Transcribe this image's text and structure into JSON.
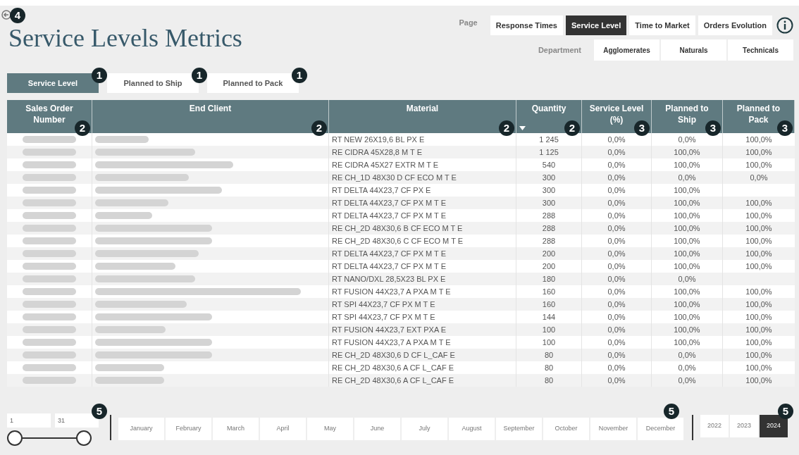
{
  "back": {
    "badge": "4"
  },
  "title": "Service Levels Metrics",
  "page_nav": {
    "label": "Page",
    "items": [
      {
        "label": "Response Times",
        "selected": false
      },
      {
        "label": "Service Level",
        "selected": true
      },
      {
        "label": "Time to Market",
        "selected": false
      },
      {
        "label": "Orders Evolution",
        "selected": false
      }
    ]
  },
  "department": {
    "label": "Department",
    "items": [
      {
        "label": "Agglomerates",
        "selected": false
      },
      {
        "label": "Naturals",
        "selected": false
      },
      {
        "label": "Technicals",
        "selected": false
      }
    ]
  },
  "view_tabs": [
    {
      "label": "Service Level",
      "selected": true,
      "badge": "1"
    },
    {
      "label": "Planned to Ship",
      "selected": false,
      "badge": "1"
    },
    {
      "label": "Planned to Pack",
      "selected": false,
      "badge": "1"
    }
  ],
  "table": {
    "columns": [
      {
        "label": "Sales Order Number",
        "badge": "2",
        "sorted": false
      },
      {
        "label": "End Client",
        "badge": "2",
        "sorted": false
      },
      {
        "label": "Material",
        "badge": "2",
        "sorted": false
      },
      {
        "label": "Quantity",
        "badge": "2",
        "sorted": true
      },
      {
        "label": "Service Level (%)",
        "badge": "3",
        "sorted": false
      },
      {
        "label": "Planned to Ship",
        "badge": "3",
        "sorted": false
      },
      {
        "label": "Planned to Pack",
        "badge": "3",
        "sorted": false
      }
    ],
    "rows": [
      {
        "material": "RT NEW 26X19,6 BL PX E",
        "quantity": "1 245",
        "service_level": "0,0%",
        "ship": "0,0%",
        "pack": "100,0%"
      },
      {
        "material": "RE CIDRA 45X28,8 M T E",
        "quantity": "1 125",
        "service_level": "0,0%",
        "ship": "100,0%",
        "pack": "100,0%"
      },
      {
        "material": "RE CIDRA 45X27 EXTR M T E",
        "quantity": "540",
        "service_level": "0,0%",
        "ship": "100,0%",
        "pack": "100,0%"
      },
      {
        "material": "RE CH_1D 48X30 D CF ECO M T E",
        "quantity": "300",
        "service_level": "0,0%",
        "ship": "0,0%",
        "pack": "0,0%"
      },
      {
        "material": "RT DELTA 44X23,7 CF PX E",
        "quantity": "300",
        "service_level": "0,0%",
        "ship": "100,0%"
      },
      {
        "material": "RT DELTA 44X23,7 CF PX M T E",
        "quantity": "300",
        "service_level": "0,0%",
        "ship": "100,0%",
        "pack": "100,0%"
      },
      {
        "material": "RT DELTA 44X23,7 CF PX M T E",
        "quantity": "288",
        "service_level": "0,0%",
        "ship": "100,0%",
        "pack": "100,0%"
      },
      {
        "material": "RE CH_2D 48X30,6 B CF ECO M T E",
        "quantity": "288",
        "service_level": "0,0%",
        "ship": "100,0%",
        "pack": "100,0%"
      },
      {
        "material": "RE CH_2D 48X30,6 C CF ECO M T E",
        "quantity": "288",
        "service_level": "0,0%",
        "ship": "100,0%",
        "pack": "100,0%"
      },
      {
        "material": "RT DELTA 44X23,7 CF PX M T E",
        "quantity": "200",
        "service_level": "0,0%",
        "ship": "100,0%",
        "pack": "100,0%"
      },
      {
        "material": "RT DELTA 44X23,7 CF PX M T E",
        "quantity": "200",
        "service_level": "0,0%",
        "ship": "100,0%",
        "pack": "100,0%"
      },
      {
        "material": "RT NANO/DXL 28,5X23 BL PX E",
        "quantity": "180",
        "service_level": "0,0%",
        "ship": "0,0%"
      },
      {
        "material": "RT FUSION 44X23,7 A PXA M T E",
        "quantity": "160",
        "service_level": "0,0%",
        "ship": "100,0%",
        "pack": "100,0%"
      },
      {
        "material": "RT SPI 44X23,7 CF PX M T E",
        "quantity": "160",
        "service_level": "0,0%",
        "ship": "100,0%",
        "pack": "100,0%"
      },
      {
        "material": "RT SPI 44X23,7 CF PX M T E",
        "quantity": "144",
        "service_level": "0,0%",
        "ship": "100,0%",
        "pack": "100,0%"
      },
      {
        "material": "RT FUSION 44X23,7 EXT PXA E",
        "quantity": "100",
        "service_level": "0,0%",
        "ship": "100,0%",
        "pack": "100,0%"
      },
      {
        "material": "RT FUSION 44X23,7 A PXA M T E",
        "quantity": "100",
        "service_level": "0,0%",
        "ship": "100,0%",
        "pack": "100,0%"
      },
      {
        "material": "RE CH_2D 48X30,6 D CF L_CAF E",
        "quantity": "80",
        "service_level": "0,0%",
        "ship": "0,0%",
        "pack": "100,0%"
      },
      {
        "material": "RE CH_2D 48X30,6 A CF L_CAF E",
        "quantity": "80",
        "service_level": "0,0%",
        "ship": "0,0%",
        "pack": "100,0%"
      },
      {
        "material": "RE CH_2D 48X30,6 A CF L_CAF E",
        "quantity": "80",
        "service_level": "0,0%",
        "ship": "0,0%",
        "pack": "100,0%"
      }
    ]
  },
  "day_slider": {
    "from": "1",
    "to": "31",
    "badge": "5",
    "thumbs": [
      {
        "level": 0
      },
      {
        "level": 1
      }
    ]
  },
  "months": {
    "badge": "5",
    "items": [
      {
        "label": "January",
        "selected": false
      },
      {
        "label": "February",
        "selected": false
      },
      {
        "label": "March",
        "selected": false
      },
      {
        "label": "April",
        "selected": false
      },
      {
        "label": "May",
        "selected": false
      },
      {
        "label": "June",
        "selected": false
      },
      {
        "label": "July",
        "selected": false
      },
      {
        "label": "August",
        "selected": false
      },
      {
        "label": "September",
        "selected": false
      },
      {
        "label": "October",
        "selected": false
      },
      {
        "label": "November",
        "selected": false
      },
      {
        "label": "December",
        "selected": false
      }
    ]
  },
  "years": {
    "badge": "5",
    "items": [
      {
        "label": "2022",
        "selected": false
      },
      {
        "label": "2023",
        "selected": false
      },
      {
        "label": "2024",
        "selected": true
      }
    ]
  }
}
